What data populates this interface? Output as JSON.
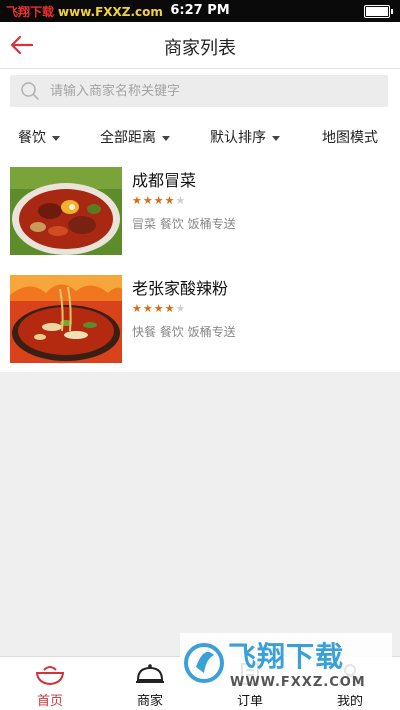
{
  "status_bar": {
    "watermark_left": "飞翔下载",
    "watermark_right": "www.FXXZ.com",
    "time": "6:27 PM"
  },
  "header": {
    "title": "商家列表"
  },
  "search": {
    "placeholder": "请输入商家名称关键字"
  },
  "filters": [
    {
      "label": "餐饮"
    },
    {
      "label": "全部距离"
    },
    {
      "label": "默认排序"
    },
    {
      "label": "地图模式"
    }
  ],
  "merchants": [
    {
      "name": "成都冒菜",
      "rating": 4,
      "max_rating": 5,
      "tags": "冒菜 餐饮 饭桶专送"
    },
    {
      "name": "老张家酸辣粉",
      "rating": 4,
      "max_rating": 5,
      "tags": "快餐 餐饮 饭桶专送"
    }
  ],
  "watermark": {
    "title": "飞翔下载",
    "url": "WWW.FXXZ.COM"
  },
  "tabbar": [
    {
      "label": "首页"
    },
    {
      "label": "商家"
    },
    {
      "label": "订单"
    },
    {
      "label": "我的"
    }
  ],
  "colors": {
    "accent": "#d2343a",
    "star": "#e06a14",
    "watermark_blue": "#3aa0d8"
  }
}
